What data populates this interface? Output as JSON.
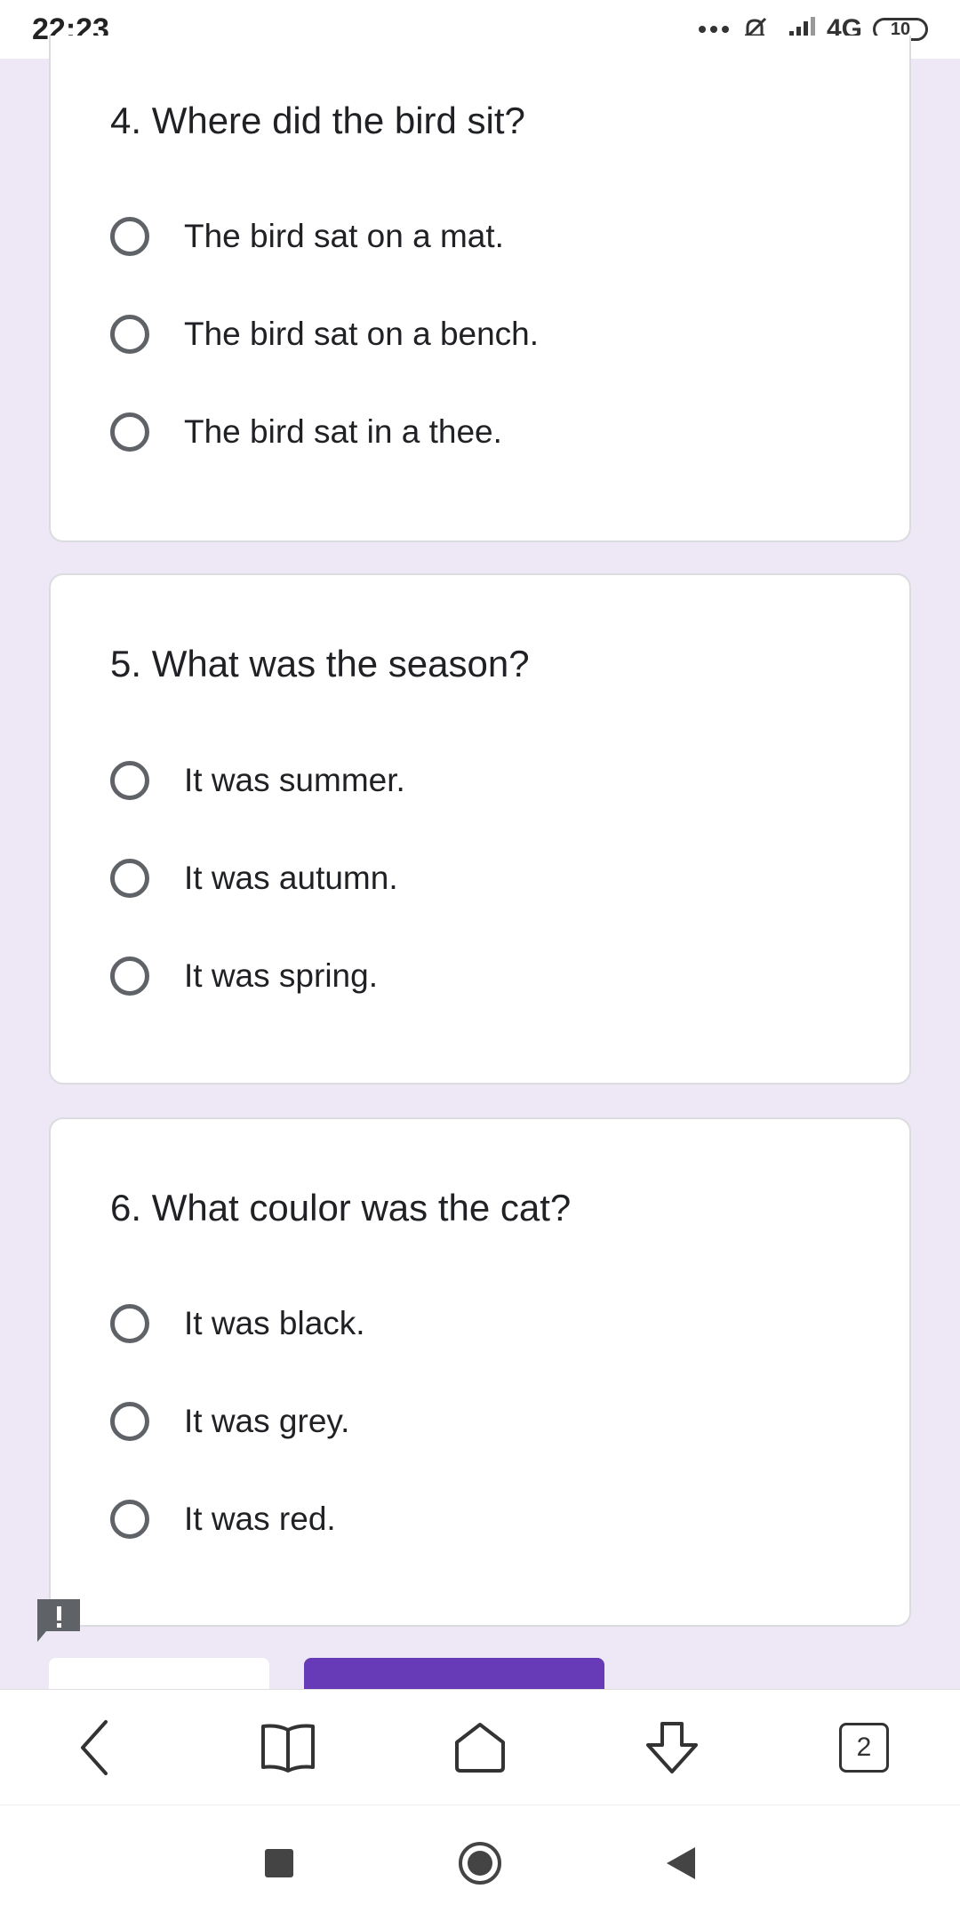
{
  "status_bar": {
    "time": "22:23",
    "network": "4G",
    "battery": "10"
  },
  "questions": [
    {
      "title": "4. Where did the bird sit?",
      "options": [
        "The bird sat on a mat.",
        "The bird sat on a bench.",
        "The bird sat in a thee."
      ]
    },
    {
      "title": "5. What was the season?",
      "options": [
        "It was summer.",
        "It was autumn.",
        "It was spring."
      ]
    },
    {
      "title": "6. What coulor was the cat?",
      "options": [
        "It was black.",
        "It was grey.",
        "It was red."
      ]
    }
  ],
  "browser_bar": {
    "tab_count": "2"
  },
  "colors": {
    "background": "#ede7f6",
    "accent": "#673ab7",
    "radio_border": "#5f6368"
  }
}
